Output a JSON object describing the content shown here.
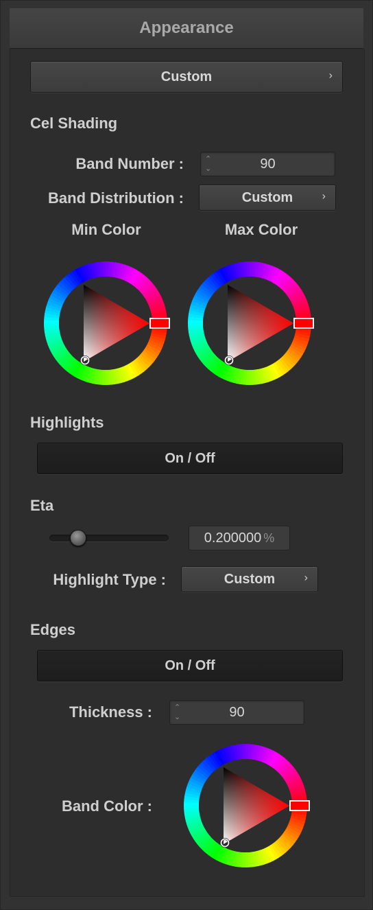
{
  "panel": {
    "title": "Appearance"
  },
  "preset": {
    "value": "Custom"
  },
  "cel_shading": {
    "heading": "Cel Shading",
    "band_number_label": "Band Number :",
    "band_number_value": "90",
    "band_distribution_label": "Band Distribution :",
    "band_distribution_value": "Custom",
    "min_color_label": "Min Color",
    "max_color_label": "Max Color",
    "min_color": {
      "hue": "#ff0000"
    },
    "max_color": {
      "hue": "#ff0000"
    }
  },
  "highlights": {
    "heading": "Highlights",
    "toggle_label": "On / Off",
    "eta_heading": "Eta",
    "eta_value": "0.200000",
    "eta_unit": "%",
    "eta_slider_fraction": 0.2,
    "highlight_type_label": "Highlight Type :",
    "highlight_type_value": "Custom"
  },
  "edges": {
    "heading": "Edges",
    "toggle_label": "On / Off",
    "thickness_label": "Thickness :",
    "thickness_value": "90",
    "band_color_label": "Band Color :",
    "band_color": {
      "hue": "#ff0000"
    }
  },
  "icons": {
    "chevron": "chevron-right-icon",
    "stepper": "stepper-up-down-icon"
  },
  "glyphs": {
    "chevron": "›",
    "up": "⌃",
    "down": "⌄"
  }
}
